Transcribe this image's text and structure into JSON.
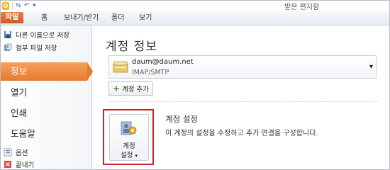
{
  "window": {
    "title": "받은 편지함"
  },
  "qat": {
    "app_letter": "O"
  },
  "ribbon": {
    "tabs": [
      {
        "label": "파일"
      },
      {
        "label": "홈"
      },
      {
        "label": "보내기/받기"
      },
      {
        "label": "폴더"
      },
      {
        "label": "보기"
      }
    ]
  },
  "sidebar": {
    "save_as": "다른 이름으로 저장",
    "save_attachments": "첨부 파일 저장",
    "items": [
      {
        "label": "정보"
      },
      {
        "label": "열기"
      },
      {
        "label": "인쇄"
      },
      {
        "label": "도움말"
      }
    ],
    "options": "옵션",
    "exit": "끝내기"
  },
  "main": {
    "heading": "계정 정보",
    "account": {
      "email": "daum@daum.net",
      "type": "IMAP/SMTP"
    },
    "add_account": "계정 추가",
    "settings_button": {
      "line1": "계정",
      "line2": "설정"
    },
    "settings_title": "계정 설정",
    "settings_desc": "이 계정의 설정을 수정하고 추가 연결을 구성합니다."
  },
  "colors": {
    "file_tab": "#cc5a25",
    "active_nav": "#e9792d",
    "highlight_box": "#c8232c"
  }
}
